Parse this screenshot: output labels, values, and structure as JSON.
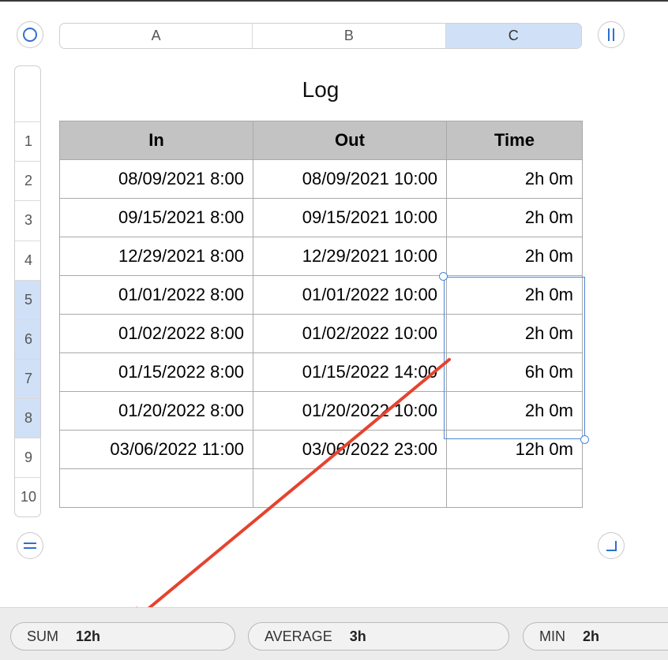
{
  "columns": [
    "A",
    "B",
    "C"
  ],
  "selected_column": "C",
  "rows": [
    "1",
    "2",
    "3",
    "4",
    "5",
    "6",
    "7",
    "8",
    "9",
    "10"
  ],
  "selected_rows": [
    "5",
    "6",
    "7",
    "8"
  ],
  "table": {
    "title": "Log",
    "headers": [
      "In",
      "Out",
      "Time"
    ],
    "data": [
      [
        "08/09/2021 8:00",
        "08/09/2021 10:00",
        "2h 0m"
      ],
      [
        "09/15/2021 8:00",
        "09/15/2021 10:00",
        "2h 0m"
      ],
      [
        "12/29/2021 8:00",
        "12/29/2021 10:00",
        "2h 0m"
      ],
      [
        "01/01/2022 8:00",
        "01/01/2022 10:00",
        "2h 0m"
      ],
      [
        "01/02/2022 8:00",
        "01/02/2022 10:00",
        "2h 0m"
      ],
      [
        "01/15/2022 8:00",
        "01/15/2022 14:00",
        "6h 0m"
      ],
      [
        "01/20/2022 8:00",
        "01/20/2022 10:00",
        "2h 0m"
      ],
      [
        "03/06/2022 11:00",
        "03/06/2022 23:00",
        "12h 0m"
      ],
      [
        "",
        "",
        ""
      ]
    ]
  },
  "status_bar": {
    "sum": {
      "label": "SUM",
      "value": "12h"
    },
    "average": {
      "label": "AVERAGE",
      "value": "3h"
    },
    "min": {
      "label": "MIN",
      "value": "2h"
    }
  },
  "colors": {
    "selection": "#4a86d8",
    "selected_header": "#cfe0f7",
    "table_header": "#c3c3c3",
    "annotation_arrow": "#e5432f"
  }
}
